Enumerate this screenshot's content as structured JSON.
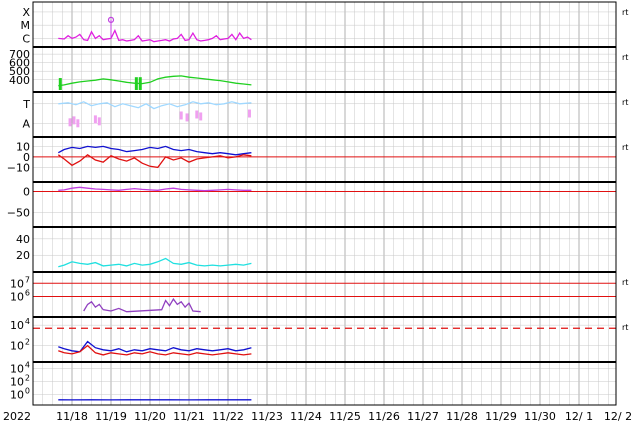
{
  "chart_data": {
    "type": "line",
    "year_label": "2022",
    "x_ticks": [
      "11/18",
      "11/19",
      "11/20",
      "11/21",
      "11/22",
      "11/23",
      "11/24",
      "11/25",
      "11/26",
      "11/27",
      "11/28",
      "11/29",
      "11/30",
      "12/ 1",
      "12/ 2"
    ],
    "colors": {
      "magenta": "#e020e0",
      "green": "#20d020",
      "lightblue": "#a0d8ff",
      "pink": "#f0a0f0",
      "blue": "#1010d0",
      "red": "#e01010",
      "purple": "#c040e0",
      "cyan": "#20e0e0",
      "darkpurple": "#9040c0",
      "grid": "#c8c8c8"
    },
    "panels": [
      {
        "id": "xray",
        "ticks": [
          {
            "label": "X",
            "v": 3
          },
          {
            "label": "M",
            "v": 2
          },
          {
            "label": "C",
            "v": 1
          }
        ],
        "ylim": [
          0.5,
          3.6
        ],
        "right_mark": "rt",
        "series": [
          {
            "color": "magenta",
            "x": [
              17.65,
              17.8,
              17.9,
              18.0,
              18.1,
              18.2,
              18.3,
              18.4,
              18.5,
              18.6,
              18.7,
              18.8,
              18.9,
              19.0,
              19.1,
              19.2,
              19.3,
              19.4,
              19.5,
              19.6,
              19.7,
              19.8,
              19.9,
              20.0,
              20.1,
              20.2,
              20.3,
              20.4,
              20.5,
              20.6,
              20.7,
              20.8,
              20.9,
              21.0,
              21.1,
              21.2,
              21.3,
              21.4,
              21.5,
              21.6,
              21.7,
              21.8,
              21.9,
              22.0,
              22.1,
              22.2,
              22.3,
              22.4,
              22.5,
              22.6
            ],
            "y": [
              1.0,
              0.95,
              1.2,
              1.0,
              1.1,
              1.3,
              0.9,
              0.85,
              1.5,
              1.0,
              1.2,
              0.9,
              0.95,
              1.0,
              1.6,
              0.85,
              0.9,
              0.8,
              0.85,
              0.9,
              1.2,
              0.8,
              0.85,
              0.9,
              0.75,
              0.8,
              0.85,
              0.9,
              0.8,
              0.95,
              1.0,
              1.3,
              0.85,
              0.9,
              1.4,
              0.9,
              0.8,
              0.85,
              0.9,
              1.0,
              1.2,
              0.9,
              0.95,
              1.0,
              1.3,
              0.9,
              1.4,
              1.0,
              1.1,
              0.9
            ]
          }
        ],
        "marker": {
          "x": 19.0,
          "y": 2.4,
          "color": "purple"
        }
      },
      {
        "id": "wind_speed",
        "ticks": [
          {
            "label": "700",
            "v": 700
          },
          {
            "label": "600",
            "v": 600
          },
          {
            "label": "500",
            "v": 500
          },
          {
            "label": "400",
            "v": 400
          }
        ],
        "ylim": [
          280,
          760
        ],
        "right_mark": "rt",
        "series": [
          {
            "color": "green",
            "x": [
              17.65,
              17.8,
              18.0,
              18.2,
              18.4,
              18.6,
              18.8,
              19.0,
              19.2,
              19.4,
              19.6,
              19.8,
              20.0,
              20.2,
              20.4,
              20.6,
              20.8,
              21.0,
              21.2,
              21.4,
              21.6,
              21.8,
              22.0,
              22.2,
              22.4,
              22.6
            ],
            "y": [
              330,
              340,
              360,
              375,
              385,
              395,
              410,
              400,
              385,
              370,
              360,
              355,
              370,
              410,
              430,
              440,
              445,
              430,
              420,
              410,
              400,
              390,
              375,
              360,
              350,
              340
            ]
          }
        ],
        "spikes": [
          {
            "x": 17.7,
            "y": 420,
            "color": "green"
          },
          {
            "x": 19.65,
            "y": 430,
            "color": "green"
          },
          {
            "x": 19.75,
            "y": 430,
            "color": "green"
          }
        ]
      },
      {
        "id": "ta",
        "ticks": [
          {
            "label": "T",
            "v": 2
          },
          {
            "label": "A",
            "v": 1
          }
        ],
        "ylim": [
          0.4,
          2.5
        ],
        "right_mark": "rt",
        "series": [
          {
            "color": "lightblue",
            "x": [
              17.65,
              17.9,
              18.1,
              18.3,
              18.5,
              18.7,
              18.9,
              19.1,
              19.3,
              19.5,
              19.7,
              19.9,
              20.1,
              20.3,
              20.5,
              20.7,
              20.9,
              21.1,
              21.3,
              21.5,
              21.7,
              21.9,
              22.1,
              22.3,
              22.6
            ],
            "y": [
              2.0,
              2.05,
              1.95,
              2.1,
              1.9,
              2.0,
              2.05,
              1.85,
              2.0,
              1.9,
              1.8,
              2.0,
              1.75,
              1.9,
              2.0,
              1.85,
              1.95,
              2.1,
              2.0,
              2.05,
              1.95,
              2.0,
              2.1,
              2.0,
              2.05
            ]
          }
        ],
        "dots": {
          "color": "pink",
          "x": [
            17.95,
            18.05,
            18.15,
            18.6,
            18.7,
            20.8,
            20.95,
            21.2,
            21.3,
            22.55
          ],
          "y": [
            1.05,
            1.15,
            1.0,
            1.2,
            1.1,
            1.4,
            1.3,
            1.45,
            1.35,
            1.5
          ]
        }
      },
      {
        "id": "bfield",
        "ticks": [
          {
            "label": "10",
            "v": 10
          },
          {
            "label": "0",
            "v": 0
          },
          {
            "label": "−10",
            "v": -10
          }
        ],
        "ylim": [
          -22,
          17
        ],
        "zero_line": true,
        "right_mark": "rt",
        "series": [
          {
            "color": "blue",
            "x": [
              17.65,
              17.8,
              18.0,
              18.2,
              18.4,
              18.6,
              18.8,
              19.0,
              19.2,
              19.4,
              19.6,
              19.8,
              20.0,
              20.2,
              20.4,
              20.6,
              20.8,
              21.0,
              21.2,
              21.4,
              21.6,
              21.8,
              22.0,
              22.2,
              22.4,
              22.6
            ],
            "y": [
              4,
              7,
              9,
              8,
              10,
              9,
              10,
              8,
              7,
              5,
              6,
              7,
              9,
              8,
              10,
              7,
              6,
              7,
              5,
              4,
              3,
              4,
              3,
              2,
              3,
              4
            ]
          },
          {
            "color": "red",
            "x": [
              17.65,
              17.8,
              18.0,
              18.2,
              18.4,
              18.6,
              18.8,
              19.0,
              19.2,
              19.4,
              19.6,
              19.8,
              20.0,
              20.2,
              20.4,
              20.6,
              20.8,
              21.0,
              21.2,
              21.4,
              21.6,
              21.8,
              22.0,
              22.2,
              22.4,
              22.6
            ],
            "y": [
              2,
              -2,
              -8,
              -4,
              2,
              -3,
              -5,
              1,
              -2,
              -4,
              -1,
              -6,
              -9,
              -10,
              0,
              -3,
              -1,
              -5,
              -2,
              -1,
              0,
              1,
              -1,
              0,
              2,
              1
            ]
          }
        ]
      },
      {
        "id": "bz_long",
        "ticks": [
          {
            "label": "0",
            "v": 0
          },
          {
            "label": "−50",
            "v": -50
          }
        ],
        "ylim": [
          -80,
          18
        ],
        "zero_line": true,
        "series": [
          {
            "color": "purple",
            "x": [
              17.65,
              17.8,
              18.0,
              18.2,
              18.4,
              18.6,
              18.8,
              19.0,
              19.2,
              19.4,
              19.6,
              19.8,
              20.0,
              20.2,
              20.4,
              20.6,
              20.8,
              21.0,
              21.2,
              21.4,
              21.6,
              21.8,
              22.0,
              22.2,
              22.4,
              22.6
            ],
            "y": [
              3,
              4,
              8,
              10,
              8,
              6,
              5,
              4,
              3,
              5,
              7,
              5,
              4,
              3,
              6,
              8,
              5,
              4,
              3,
              2,
              3,
              4,
              5,
              4,
              3,
              3
            ]
          }
        ]
      },
      {
        "id": "density",
        "ticks": [
          {
            "label": "40",
            "v": 40
          },
          {
            "label": "20",
            "v": 20
          }
        ],
        "ylim": [
          2,
          52
        ],
        "series": [
          {
            "color": "cyan",
            "x": [
              17.65,
              17.8,
              18.0,
              18.2,
              18.4,
              18.6,
              18.8,
              19.0,
              19.2,
              19.4,
              19.6,
              19.8,
              20.0,
              20.2,
              20.4,
              20.6,
              20.8,
              21.0,
              21.2,
              21.4,
              21.6,
              21.8,
              22.0,
              22.2,
              22.4,
              22.6
            ],
            "y": [
              6,
              8,
              12,
              10,
              9,
              11,
              7,
              8,
              9,
              7,
              10,
              8,
              9,
              12,
              16,
              10,
              9,
              11,
              8,
              7,
              8,
              7,
              8,
              9,
              8,
              10
            ]
          }
        ]
      },
      {
        "id": "electron",
        "ticks": [
          {
            "label": "10",
            "sup": "7",
            "v": 7
          },
          {
            "label": "10",
            "sup": "6",
            "v": 6
          }
        ],
        "ylim": [
          4.6,
          7.7
        ],
        "right_mark": "rt",
        "hlines": [
          {
            "v": 7,
            "color": "red"
          },
          {
            "v": 6,
            "color": "red"
          }
        ],
        "series": [
          {
            "color": "darkpurple",
            "x": [
              18.3,
              18.4,
              18.5,
              18.6,
              18.7,
              18.8,
              19.0,
              19.2,
              19.4,
              20.3,
              20.4,
              20.5,
              20.6,
              20.7,
              20.8,
              20.9,
              21.0,
              21.1,
              21.3
            ],
            "y": [
              4.9,
              5.4,
              5.6,
              5.2,
              5.4,
              5.0,
              4.9,
              5.1,
              4.85,
              5.0,
              5.7,
              5.3,
              5.8,
              5.4,
              5.6,
              5.2,
              5.5,
              4.9,
              4.85
            ]
          }
        ]
      },
      {
        "id": "proton",
        "ticks": [
          {
            "label": "10",
            "sup": "4",
            "v": 4
          },
          {
            "label": "10",
            "sup": "2",
            "v": 2
          }
        ],
        "ylim": [
          0.6,
          4.6
        ],
        "right_mark": "rt",
        "dashed_line": {
          "v": 3.7,
          "color": "red"
        },
        "series": [
          {
            "color": "blue",
            "x": [
              17.65,
              17.8,
              18.0,
              18.2,
              18.4,
              18.6,
              18.8,
              19.0,
              19.2,
              19.4,
              19.6,
              19.8,
              20.0,
              20.2,
              20.4,
              20.6,
              20.8,
              21.0,
              21.2,
              21.4,
              21.6,
              21.8,
              22.0,
              22.2,
              22.4,
              22.6
            ],
            "y": [
              1.9,
              1.7,
              1.5,
              1.4,
              2.4,
              1.8,
              1.6,
              1.5,
              1.7,
              1.4,
              1.6,
              1.5,
              1.7,
              1.6,
              1.5,
              1.8,
              1.6,
              1.5,
              1.7,
              1.6,
              1.5,
              1.6,
              1.7,
              1.5,
              1.6,
              1.8
            ]
          },
          {
            "color": "red",
            "x": [
              17.65,
              17.8,
              18.0,
              18.2,
              18.4,
              18.6,
              18.8,
              19.0,
              19.2,
              19.4,
              19.6,
              19.8,
              20.0,
              20.2,
              20.4,
              20.6,
              20.8,
              21.0,
              21.2,
              21.4,
              21.6,
              21.8,
              22.0,
              22.2,
              22.4,
              22.6
            ],
            "y": [
              1.5,
              1.3,
              1.2,
              1.4,
              2.0,
              1.3,
              1.1,
              1.3,
              1.2,
              1.1,
              1.3,
              1.2,
              1.4,
              1.2,
              1.1,
              1.3,
              1.2,
              1.1,
              1.3,
              1.2,
              1.1,
              1.2,
              1.3,
              1.2,
              1.1,
              1.2
            ]
          }
        ]
      },
      {
        "id": "bottom",
        "ticks": [
          {
            "label": "10",
            "sup": "4",
            "v": 4
          },
          {
            "label": "10",
            "sup": "2",
            "v": 2
          },
          {
            "label": "10",
            "sup": "0",
            "v": 0
          }
        ],
        "ylim": [
          -1.3,
          4.7
        ],
        "series": [
          {
            "color": "blue",
            "x": [
              17.65,
              18.0,
              18.5,
              19.0,
              19.5,
              20.0,
              20.5,
              21.0,
              21.5,
              22.0,
              22.6
            ],
            "y": [
              -0.8,
              -0.82,
              -0.8,
              -0.83,
              -0.8,
              -0.81,
              -0.8,
              -0.82,
              -0.8,
              -0.81,
              -0.8
            ]
          }
        ]
      }
    ]
  }
}
